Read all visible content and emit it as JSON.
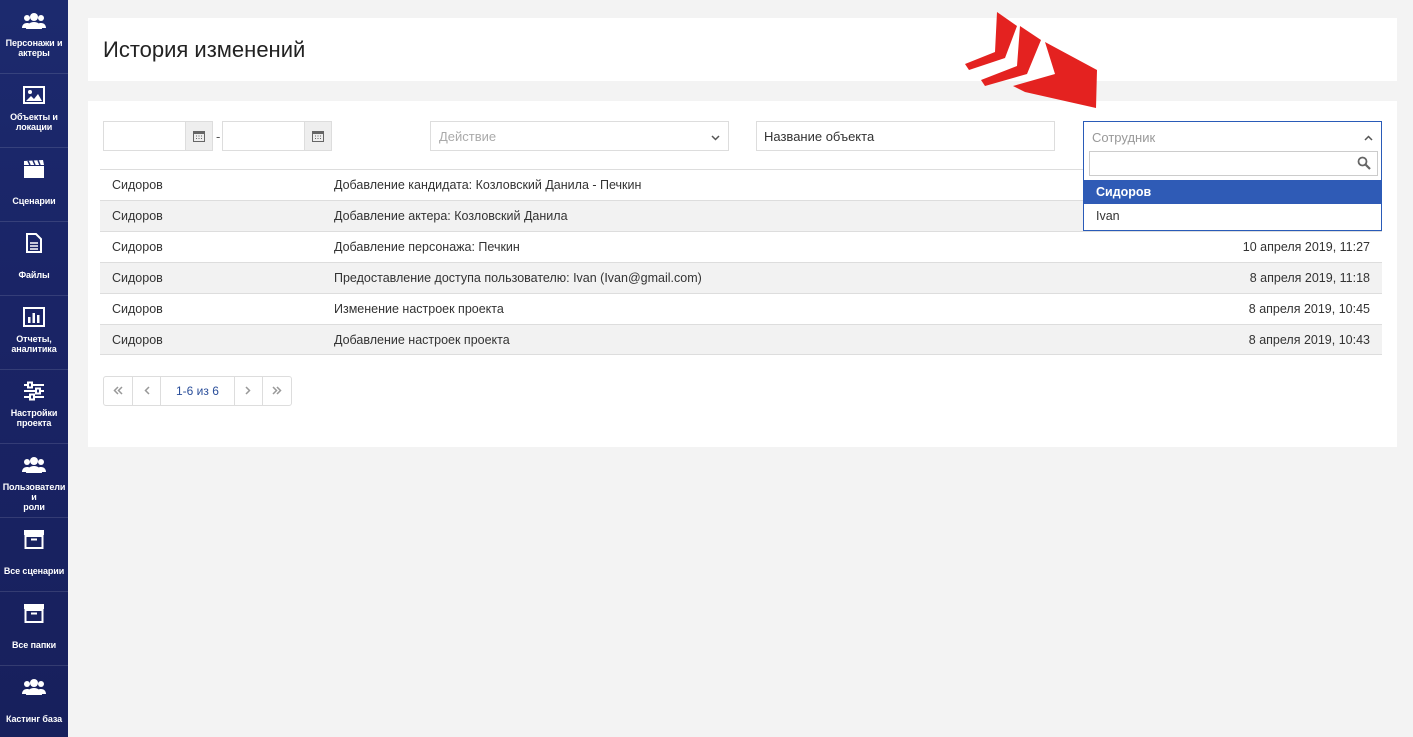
{
  "sidebar": {
    "items": [
      {
        "label": "Персонажи и\nактеры",
        "icon": "users-icon"
      },
      {
        "label": "Объекты и\nлокации",
        "icon": "image-icon"
      },
      {
        "label": "Сценарии",
        "icon": "clapperboard-icon"
      },
      {
        "label": "Файлы",
        "icon": "file-icon"
      },
      {
        "label": "Отчеты,\nаналитика",
        "icon": "bar-chart-icon"
      },
      {
        "label": "Настройки\nпроекта",
        "icon": "sliders-icon"
      },
      {
        "label": "Пользователи и\nроли",
        "icon": "users-icon"
      },
      {
        "label": "Все сценарии",
        "icon": "archive-icon"
      },
      {
        "label": "Все папки",
        "icon": "archive-icon"
      },
      {
        "label": "Кастинг база",
        "icon": "users-icon"
      }
    ]
  },
  "header": {
    "title": "История изменений"
  },
  "filters": {
    "date_from": "",
    "date_separator": "-",
    "date_to": "",
    "action_placeholder": "Действие",
    "object_name": "Название объекта",
    "employee_placeholder": "Сотрудник",
    "employee_search": "",
    "employee_options": [
      {
        "label": "Сидоров",
        "selected": true
      },
      {
        "label": "Ivan",
        "selected": false
      }
    ]
  },
  "history": {
    "rows": [
      {
        "user": "Сидоров",
        "action": "Добавление кандидата: Козловский Данила - Печкин",
        "date": ""
      },
      {
        "user": "Сидоров",
        "action": "Добавление актера: Козловский Данила",
        "date": ""
      },
      {
        "user": "Сидоров",
        "action": "Добавление персонажа: Печкин",
        "date": "10 апреля 2019, 11:27"
      },
      {
        "user": "Сидоров",
        "action": "Предоставление доступа пользователю: Ivan (Ivan@gmail.com)",
        "date": "8 апреля 2019, 11:18"
      },
      {
        "user": "Сидоров",
        "action": "Изменение настроек проекта",
        "date": "8 апреля 2019, 10:45"
      },
      {
        "user": "Сидоров",
        "action": "Добавление настроек проекта",
        "date": "8 апреля 2019, 10:43"
      }
    ]
  },
  "pagination": {
    "info": "1-6 из 6"
  },
  "colors": {
    "sidebar": "#1c2a6e",
    "accent": "#2f5bb6",
    "arrow": "#e42220"
  }
}
